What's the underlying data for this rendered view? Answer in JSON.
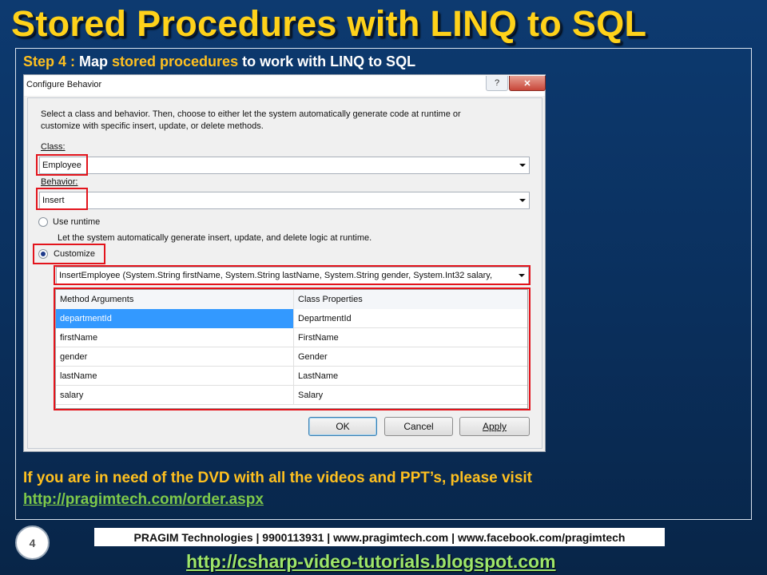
{
  "slide": {
    "title": "Stored Procedures with LINQ to SQL",
    "step_prefix": "Step 4 : ",
    "step_map": "Map ",
    "step_highlight": "stored procedures",
    "step_rest": " to work with LINQ to SQL",
    "dvd_text": "If you are in need of the DVD with all the videos and PPT’s, please visit",
    "dvd_link": "http://pragimtech.com/order.aspx",
    "page_number": "4",
    "footer": "PRAGIM Technologies | 9900113931 | www.pragimtech.com | www.facebook.com/pragimtech",
    "blog_link": "http://csharp-video-tutorials.blogspot.com"
  },
  "dialog": {
    "title": "Configure Behavior",
    "help_label": "?",
    "close_label": "✕",
    "instructions_line1": "Select a class and behavior.  Then, choose to either let the system automatically generate code at runtime or",
    "instructions_line2": "customize with specific insert, update, or delete methods.",
    "class_label": "Class:",
    "class_value": "Employee",
    "behavior_label": "Behavior:",
    "behavior_value": "Insert",
    "use_runtime_label": "Use runtime",
    "use_runtime_desc": "Let the system automatically generate insert, update, and delete logic at runtime.",
    "customize_label": "Customize",
    "method_value": "InsertEmployee (System.String firstName, System.String lastName, System.String gender, System.Int32 salary,",
    "grid": {
      "columns": [
        "Method Arguments",
        "Class Properties"
      ],
      "rows": [
        [
          "departmentId",
          "DepartmentId"
        ],
        [
          "firstName",
          "FirstName"
        ],
        [
          "gender",
          "Gender"
        ],
        [
          "lastName",
          "LastName"
        ],
        [
          "salary",
          "Salary"
        ]
      ],
      "selected_row": 0
    },
    "buttons": {
      "ok": "OK",
      "cancel": "Cancel",
      "apply": "Apply"
    }
  },
  "colors": {
    "title": "#ffd21a",
    "highlight": "#ffc01f",
    "link": "#7ec94a",
    "annotation_red": "#e3141c",
    "selection": "#3399ff"
  }
}
